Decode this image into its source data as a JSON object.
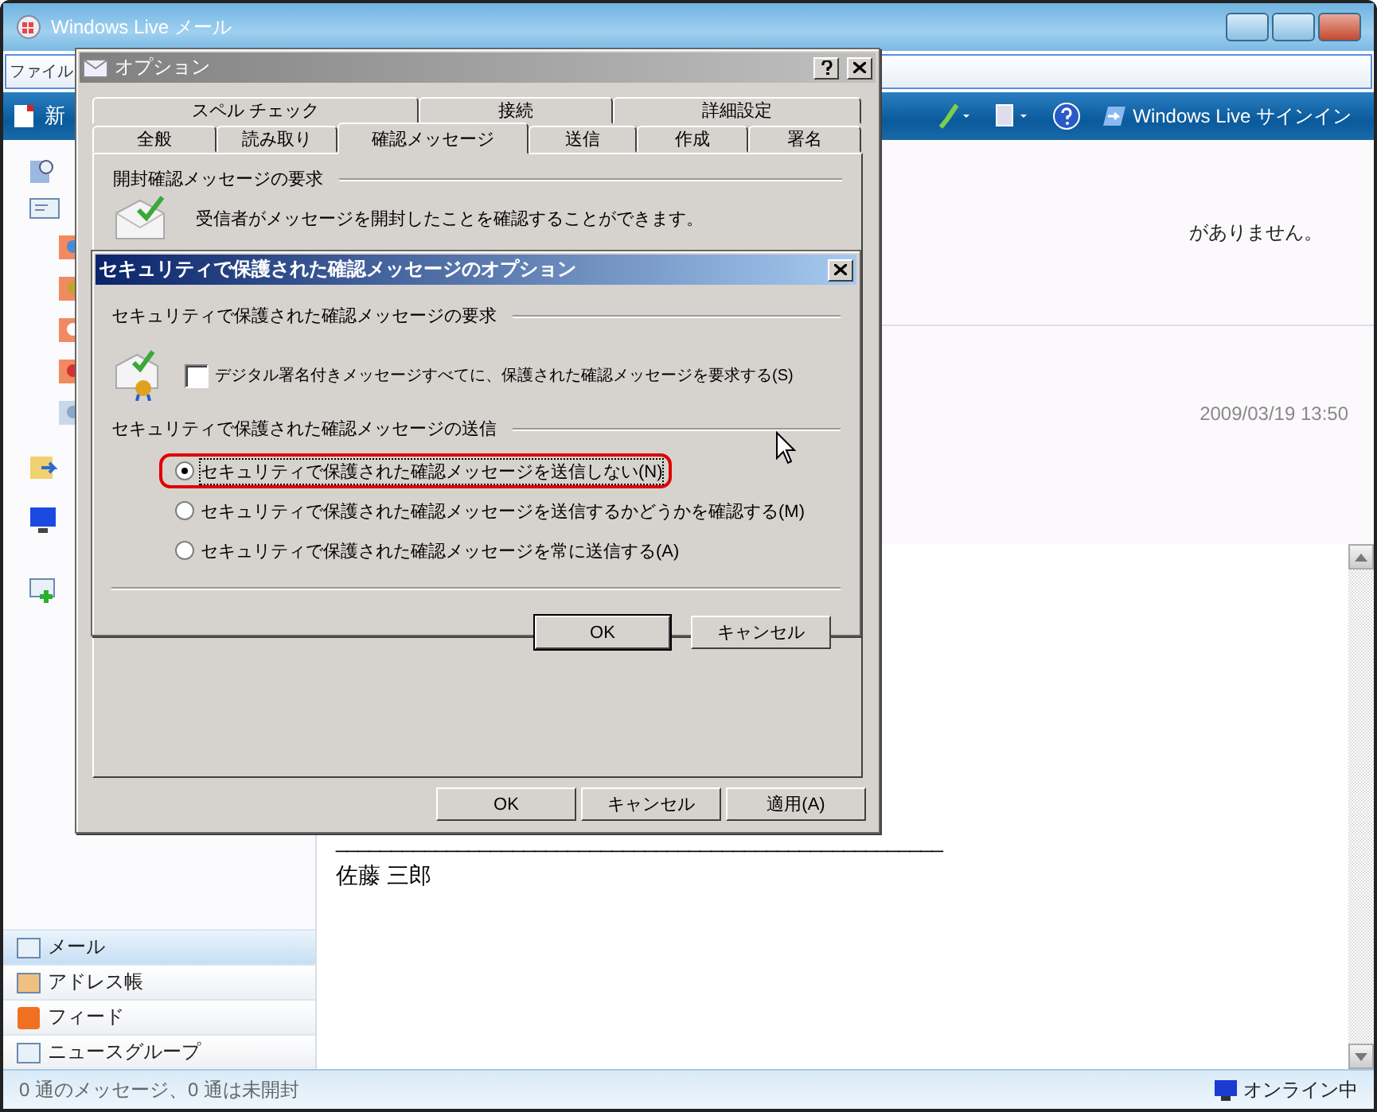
{
  "main_window": {
    "title": "Windows Live メール",
    "menu": [
      "ファイル"
    ],
    "toolbar": {
      "new_label": "新",
      "signin": "Windows Live サインイン"
    },
    "sidebar": {
      "nav": [
        {
          "label": "メール",
          "selected": true
        },
        {
          "label": "アドレス帳",
          "selected": false
        },
        {
          "label": "フィード",
          "selected": false
        },
        {
          "label": "ニュースグループ",
          "selected": false
        }
      ]
    },
    "message_list": {
      "notice": "がありません。",
      "date": "2009/03/19 13:50"
    },
    "preview": {
      "separator": "_______________________________________________________",
      "signature": "佐藤 三郎"
    },
    "status_bar": {
      "count": "0 通のメッセージ、0 通は未開封",
      "connection": "オンライン中"
    }
  },
  "options_dialog": {
    "title": "オプション",
    "tab_rows": [
      [
        {
          "label": "スペル チェック",
          "selected": false
        },
        {
          "label": "接続",
          "selected": false
        },
        {
          "label": "詳細設定",
          "selected": false
        }
      ],
      [
        {
          "label": "全般",
          "selected": false
        },
        {
          "label": "読み取り",
          "selected": false
        },
        {
          "label": "確認メッセージ",
          "selected": true
        },
        {
          "label": "送信",
          "selected": false
        },
        {
          "label": "作成",
          "selected": false
        },
        {
          "label": "署名",
          "selected": false
        }
      ]
    ],
    "section": "開封確認メッセージの要求",
    "description": "受信者がメッセージを開封したことを確認することができます。",
    "buttons": [
      "OK",
      "キャンセル",
      "適用(A)"
    ]
  },
  "security_dialog": {
    "title": "セキュリティで保護された確認メッセージのオプション",
    "request_section": "セキュリティで保護された確認メッセージの要求",
    "checkbox": {
      "label": "デジタル署名付きメッセージすべてに、保護された確認メッセージを要求する(S)",
      "checked": false
    },
    "send_section": "セキュリティで保護された確認メッセージの送信",
    "options": [
      {
        "label": "セキュリティで保護された確認メッセージを送信しない(N)",
        "selected": true,
        "circled": true
      },
      {
        "label": "セキュリティで保護された確認メッセージを送信するかどうかを確認する(M)",
        "selected": false,
        "circled": false
      },
      {
        "label": "セキュリティで保護された確認メッセージを常に送信する(A)",
        "selected": false,
        "circled": false
      }
    ],
    "buttons": [
      "OK",
      "キャンセル"
    ]
  }
}
